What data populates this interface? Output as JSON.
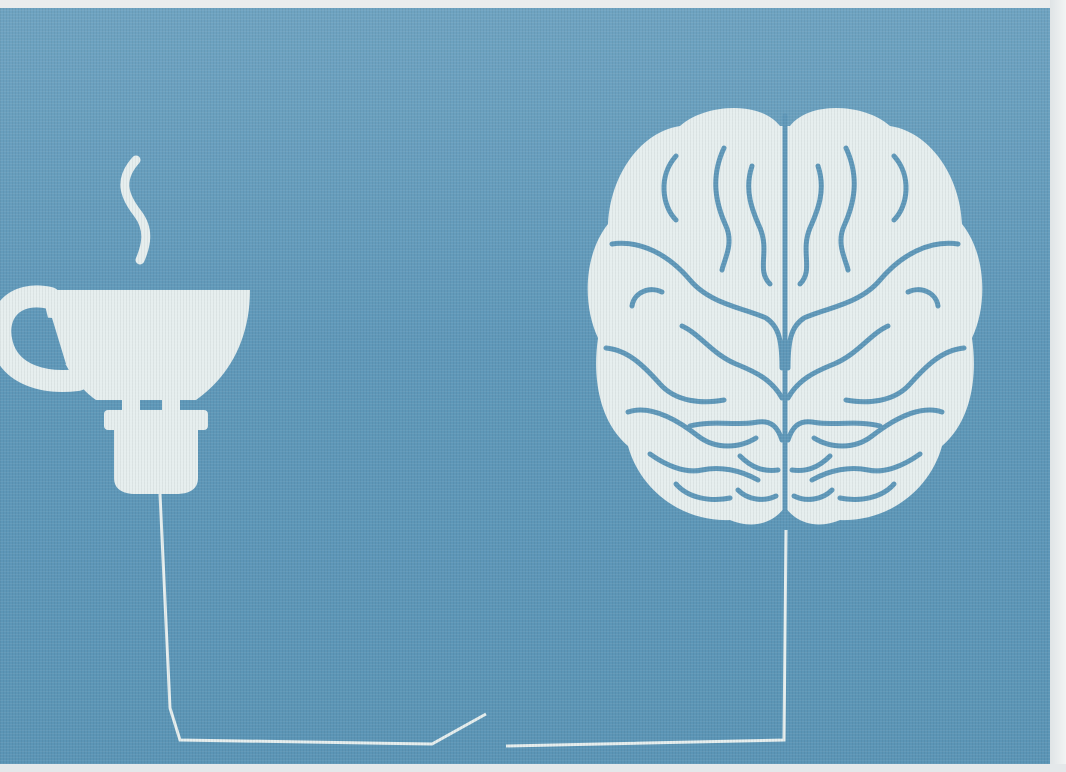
{
  "scene": {
    "background_color": "#5f98b9",
    "foreground_color": "#e6eeee",
    "frame_color": "#e9eced",
    "icons": [
      "coffee-cup-icon",
      "power-plug-icon",
      "brain-icon",
      "wire-switch-icon"
    ]
  }
}
